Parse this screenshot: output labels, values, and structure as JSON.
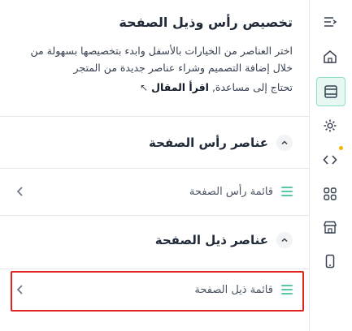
{
  "panel": {
    "title": "تخصيص رأس وذيل الصفحة",
    "description": "اختر العناصر من الخيارات بالأسفل وابدء بتخصيصها بسهولة من خلال إضافة التصميم وشراء عناصر جديدة من المتجر",
    "help_prefix": "تحتاج إلى مساعدة,",
    "help_link": "اقرأ المقال"
  },
  "sections": [
    {
      "label": "عناصر رأس الصفحة",
      "item": "قائمة رأس الصفحة"
    },
    {
      "label": "عناصر ذيل الصفحة",
      "item": "قائمة ذيل الصفحة"
    }
  ],
  "sidebar": {
    "items": [
      "collapse-icon",
      "home-icon",
      "layout-icon",
      "gear-icon",
      "code-icon",
      "grid-icon",
      "store-icon",
      "mobile-icon"
    ],
    "active": "layout-icon",
    "accent": "#5ac8a3",
    "notice_color": "#f5b700"
  }
}
